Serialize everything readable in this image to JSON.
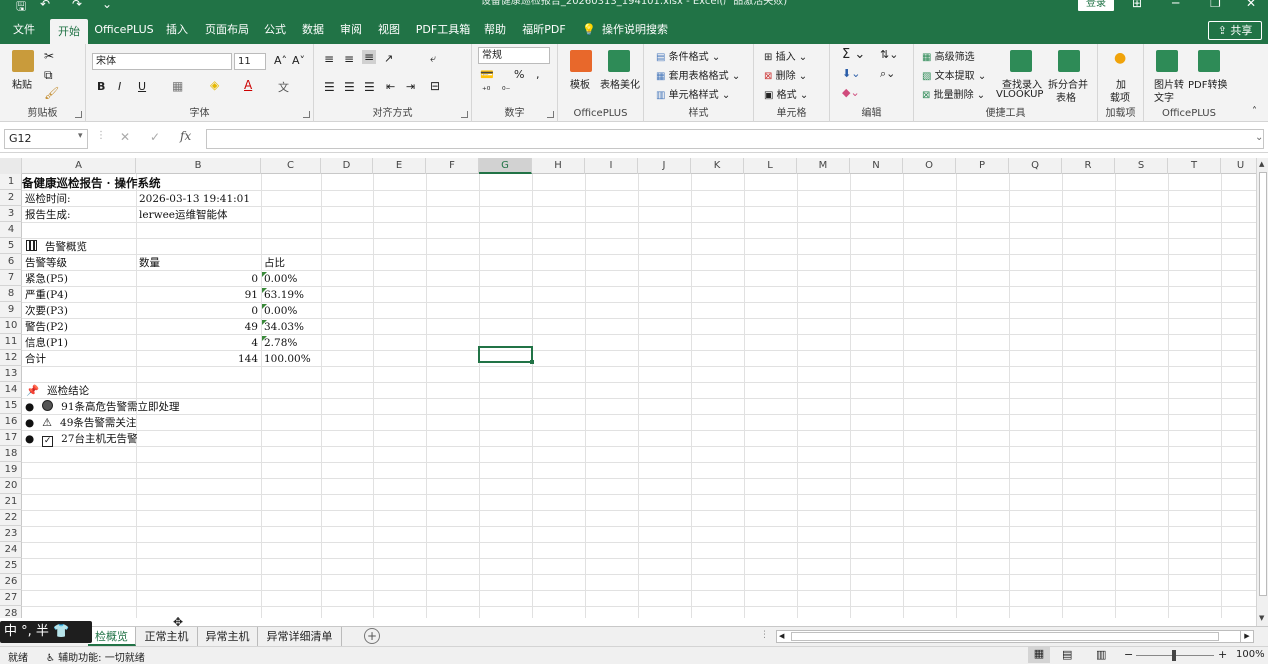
{
  "window": {
    "title": "设备健康巡检报告_20260313_194101.xlsx  -  Excel(产品激活失败)",
    "login_label": "登录",
    "share_label": "共享"
  },
  "tabs": [
    "文件",
    "开始",
    "OfficePLUS",
    "插入",
    "页面布局",
    "公式",
    "数据",
    "审阅",
    "视图",
    "PDF工具箱",
    "帮助",
    "福昕PDF",
    "操作说明搜索"
  ],
  "active_tab": "开始",
  "ribbon": {
    "clipboard": {
      "paste": "粘贴",
      "label": "剪贴板"
    },
    "font": {
      "name": "宋体",
      "size": "11",
      "bold": "B",
      "italic": "I",
      "underline": "U",
      "label": "字体"
    },
    "alignment": {
      "label": "对齐方式"
    },
    "number": {
      "format": "常规",
      "percent": "%",
      "comma": ",",
      "label": "数字"
    },
    "officeplus": {
      "template": "模板",
      "beautify": "表格美化",
      "label": "OfficePLUS"
    },
    "styles": {
      "conditional": "条件格式",
      "table": "套用表格格式",
      "cell": "单元格样式",
      "label": "样式"
    },
    "cells": {
      "insert": "插入",
      "delete": "删除",
      "format": "格式",
      "label": "单元格"
    },
    "editing": {
      "label": "编辑"
    },
    "tools": {
      "filter": "高级筛选",
      "extract": "文本提取",
      "batch_delete": "批量删除",
      "vlookup_1": "查找录入",
      "vlookup_2": "VLOOKUP",
      "split_1": "拆分合并",
      "split_2": "表格",
      "label": "便捷工具"
    },
    "addins": {
      "l1": "加",
      "l2": "载项",
      "label": "加载项"
    },
    "officeplus2": {
      "img_1": "图片转",
      "img_2": "文字",
      "pdf_1": "PDF转换",
      "label": "OfficePLUS"
    }
  },
  "formula_bar": {
    "name_box": "G12",
    "fx": "fx",
    "content": ""
  },
  "columns": [
    "A",
    "B",
    "C",
    "D",
    "E",
    "F",
    "G",
    "H",
    "I",
    "J",
    "K",
    "L",
    "M",
    "N",
    "O",
    "P",
    "Q",
    "R",
    "S",
    "T",
    "U"
  ],
  "rows": [
    "1",
    "2",
    "3",
    "4",
    "5",
    "6",
    "7",
    "8",
    "9",
    "10",
    "11",
    "12",
    "13",
    "14",
    "15",
    "16",
    "17",
    "18",
    "19",
    "20",
    "21",
    "22",
    "23",
    "24",
    "25",
    "26",
    "27",
    "28"
  ],
  "sheet": {
    "r1": "备健康巡检报告 · 操作系统",
    "r2_label": "巡检时间:",
    "r2_value": "2026-03-13 19:41:01",
    "r3_label": "报告生成:",
    "r3_value": "lerwee运维智能体",
    "r5": "告警概览",
    "header": {
      "level": "告警等级",
      "count": "数量",
      "ratio": "占比"
    },
    "levels": [
      {
        "level": "紧急(P5)",
        "count": "0",
        "ratio": "0.00%"
      },
      {
        "level": "严重(P4)",
        "count": "91",
        "ratio": "63.19%"
      },
      {
        "level": "次要(P3)",
        "count": "0",
        "ratio": "0.00%"
      },
      {
        "level": "警告(P2)",
        "count": "49",
        "ratio": "34.03%"
      },
      {
        "level": "信息(P1)",
        "count": "4",
        "ratio": "2.78%"
      },
      {
        "level": "合计",
        "count": "144",
        "ratio": "100.00%"
      }
    ],
    "r14": "巡检结论",
    "conclusions": [
      "91条高危告警需立即处理",
      "49条告警需关注",
      "27台主机无告警"
    ]
  },
  "sheet_tabs": [
    "检概览",
    "正常主机",
    "异常主机",
    "异常详细清单"
  ],
  "active_sheet": "检概览",
  "ime": "中 °, 半",
  "status": {
    "ready": "就绪",
    "accessibility": "辅助功能: 一切就绪",
    "zoom": "100%"
  }
}
